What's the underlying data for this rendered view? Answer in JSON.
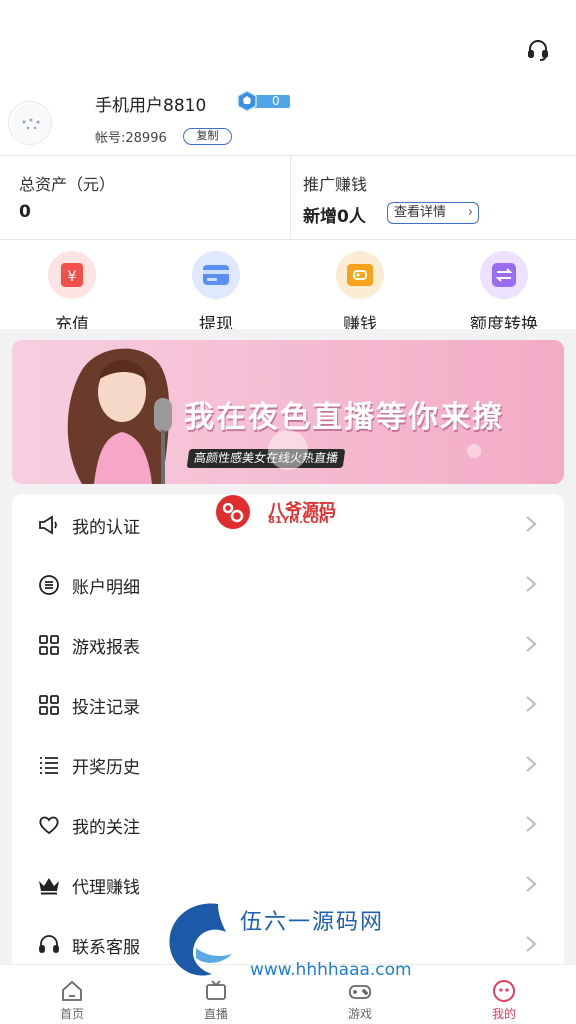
{
  "profile": {
    "username": "手机用户8810",
    "level": "0",
    "account_label": "帐号:28996",
    "copy_label": "复制"
  },
  "assets": {
    "total_label": "总资产（元）",
    "total_value": "0",
    "promo_label": "推广赚钱",
    "promo_value": "新增0人",
    "detail_label": "查看详情"
  },
  "quick_actions": [
    {
      "label": "充值",
      "icon": "yuan-icon",
      "color": "#f2504a"
    },
    {
      "label": "提现",
      "icon": "card-icon",
      "color": "#5c8ff0"
    },
    {
      "label": "赚钱",
      "icon": "wallet-icon",
      "color": "#f5a31a"
    },
    {
      "label": "额度转换",
      "icon": "transfer-icon",
      "color": "#9a6cf0"
    }
  ],
  "banner": {
    "title": "我在夜色直播等你来撩",
    "subtitle": "高颜性感美女在线火热直播"
  },
  "menu": [
    {
      "label": "我的认证",
      "icon": "megaphone-icon"
    },
    {
      "label": "账户明细",
      "icon": "list-circle-icon"
    },
    {
      "label": "游戏报表",
      "icon": "grid-icon"
    },
    {
      "label": "投注记录",
      "icon": "grid-icon"
    },
    {
      "label": "开奖历史",
      "icon": "list-icon"
    },
    {
      "label": "我的关注",
      "icon": "heart-icon"
    },
    {
      "label": "代理赚钱",
      "icon": "crown-icon"
    },
    {
      "label": "联系客服",
      "icon": "headset-icon"
    }
  ],
  "tabs": [
    {
      "label": "首页",
      "icon": "home-icon",
      "active": false
    },
    {
      "label": "直播",
      "icon": "live-icon",
      "active": false
    },
    {
      "label": "游戏",
      "icon": "gamepad-icon",
      "active": false
    },
    {
      "label": "我的",
      "icon": "profile-face-icon",
      "active": true
    }
  ],
  "watermarks": {
    "wm1_text": "八爷源码",
    "wm1_url": "81YM.COM",
    "wm2_text": "伍六一源码网",
    "wm2_url": "www.hhhhaaa.com"
  },
  "colors": {
    "accent": "#3f6fd0",
    "active_tab": "#e73c5b",
    "level_badge": "#4ea6e8"
  }
}
